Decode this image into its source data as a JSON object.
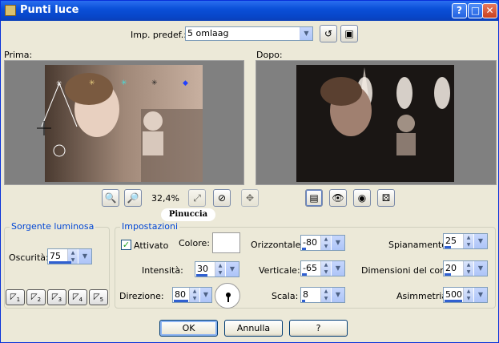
{
  "window": {
    "title": "Punti luce"
  },
  "preset": {
    "label": "Imp. predef.:",
    "value": "5 omlaag"
  },
  "preview": {
    "before_label": "Prima:",
    "after_label": "Dopo:",
    "zoom": "32,4%",
    "watermark": "Pinuccia"
  },
  "source": {
    "group_title": "Sorgente luminosa",
    "darkness_label": "Oscurità:",
    "darkness_value": "75",
    "light_buttons": [
      "1",
      "2",
      "3",
      "4",
      "5"
    ]
  },
  "settings": {
    "group_title": "Impostazioni",
    "enabled_label": "Attivato",
    "enabled": true,
    "color_label": "Colore:",
    "color_value": "#ffffff",
    "intensity_label": "Intensità:",
    "intensity_value": "30",
    "direction_label": "Direzione:",
    "direction_value": "80",
    "horizontal_label": "Orizzontale:",
    "horizontal_value": "-80",
    "vertical_label": "Verticale:",
    "vertical_value": "-65",
    "scale_label": "Scala:",
    "scale_value": "8",
    "smoothing_label": "Spianamento:",
    "smoothing_value": "25",
    "cone_label": "Dimensioni del cono:",
    "cone_value": "20",
    "asymmetry_label": "Asimmetria:",
    "asymmetry_value": "500"
  },
  "buttons": {
    "ok": "OK",
    "cancel": "Annulla",
    "help": "?"
  }
}
